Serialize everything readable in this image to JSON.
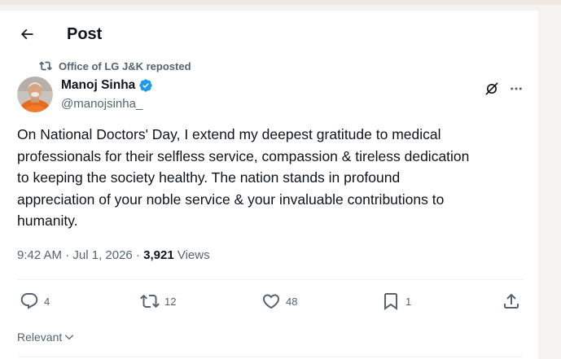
{
  "header": {
    "title": "Post",
    "back_icon": "arrow-left-icon"
  },
  "repost": {
    "icon": "repost-icon",
    "text": "Office of LG J&K reposted"
  },
  "author": {
    "name": "Manoj Sinha",
    "handle": "@manojsinha_",
    "verified": true,
    "verified_color": "#1d9bf0"
  },
  "tweet": {
    "text": "On National Doctors' Day, I extend my deepest gratitude to medical\nprofessionals for their selfless service, compassion & tireless dedication\nto keeping the society healthy. The nation stands in profound\nappreciation of your noble service & your invaluable contributions to\nhumanity.",
    "time": "9:42 AM",
    "separator": "·",
    "date": "Jul 1, 2026",
    "views_count": "3,921",
    "views_label": "Views"
  },
  "actions": {
    "replies": "4",
    "reposts": "12",
    "likes": "48",
    "bookmarks": "1"
  },
  "sort": {
    "label": "Relevant"
  },
  "colors": {
    "text_primary": "#0f1419",
    "text_secondary": "#536471",
    "divider": "#eff3f4",
    "accent": "#1d9bf0"
  }
}
